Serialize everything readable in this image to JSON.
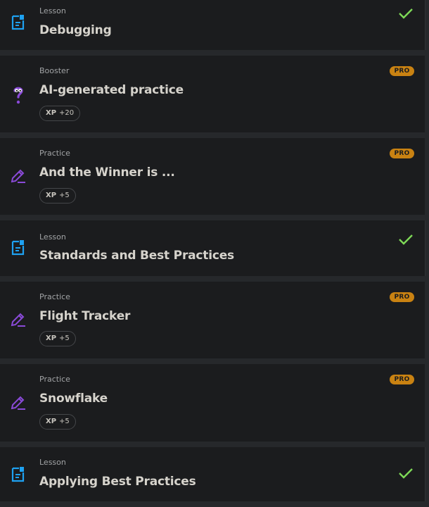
{
  "items": [
    {
      "type_label": "Lesson",
      "title": "Debugging",
      "status": "completed",
      "icon": "lesson-doc-icon"
    },
    {
      "type_label": "Booster",
      "title": "AI-generated practice",
      "xp_label": "XP",
      "xp_value": "+20",
      "pro_badge": "PRO",
      "icon": "question-mark-icon"
    },
    {
      "type_label": "Practice",
      "title": "And the Winner is ...",
      "xp_label": "XP",
      "xp_value": "+5",
      "pro_badge": "PRO",
      "icon": "pencil-edit-icon"
    },
    {
      "type_label": "Lesson",
      "title": "Standards and Best Practices",
      "status": "completed",
      "icon": "lesson-doc-icon"
    },
    {
      "type_label": "Practice",
      "title": "Flight Tracker",
      "xp_label": "XP",
      "xp_value": "+5",
      "pro_badge": "PRO",
      "icon": "pencil-edit-icon"
    },
    {
      "type_label": "Practice",
      "title": "Snowflake",
      "xp_label": "XP",
      "xp_value": "+5",
      "pro_badge": "PRO",
      "icon": "pencil-edit-icon"
    },
    {
      "type_label": "Lesson",
      "title": "Applying Best Practices",
      "status": "completed",
      "icon": "lesson-doc-icon"
    }
  ],
  "colors": {
    "background": "#26282b",
    "card": "#1b1c1e",
    "lesson_icon": "#1ea1f1",
    "practice_icon": "#8a4ad8",
    "pro_badge": "#c98212",
    "check": "#7ed957"
  }
}
